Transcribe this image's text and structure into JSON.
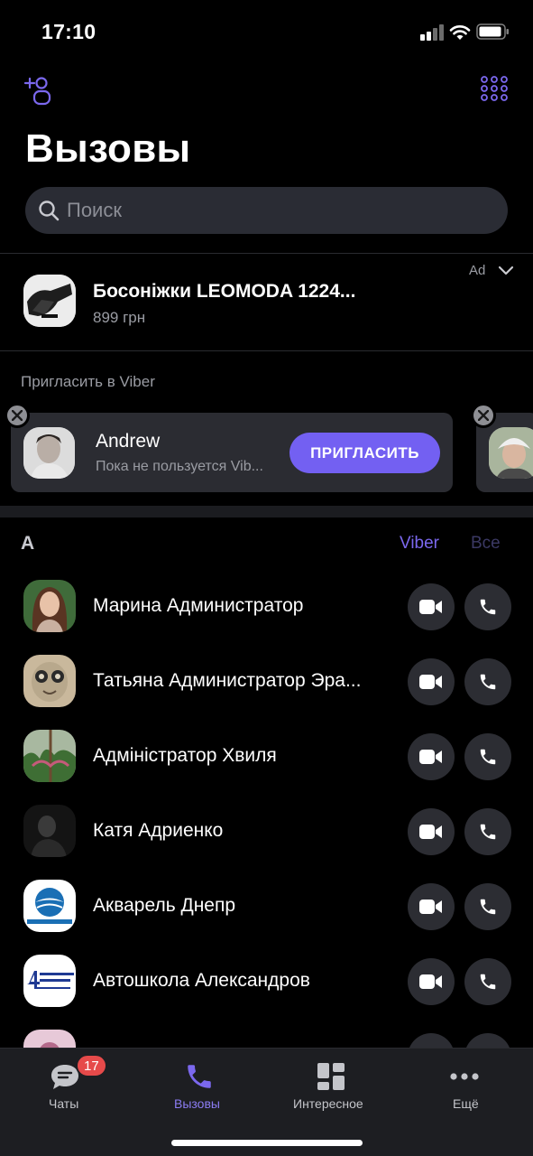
{
  "status_bar": {
    "time": "17:10"
  },
  "header": {
    "title": "Вызовы"
  },
  "search": {
    "placeholder": "Поиск"
  },
  "ad": {
    "title": "Босоніжки LEOMODA 1224...",
    "price": "899 грн",
    "label": "Ad"
  },
  "invite": {
    "heading": "Пригласить в Viber",
    "contact_name": "Andrew",
    "subtitle": "Пока не пользуется Vib...",
    "button_label": "ПРИГЛАСИТЬ"
  },
  "contacts_section": {
    "letter": "А",
    "filter_viber": "Viber",
    "filter_all": "Все",
    "contacts": [
      {
        "name": "Марина Администратор"
      },
      {
        "name": "Татьяна Администратор Эра..."
      },
      {
        "name": "Адміністратор Хвиля"
      },
      {
        "name": "Катя Адриенко"
      },
      {
        "name": "Акварель Днепр"
      },
      {
        "name": "Автошкола Александров"
      },
      {
        "name": ""
      }
    ]
  },
  "tabbar": {
    "chats": "Чаты",
    "chats_badge": "17",
    "calls": "Вызовы",
    "explore": "Интересное",
    "more": "Ещё"
  },
  "colors": {
    "accent": "#7360f2",
    "accent_text": "#7b68ee",
    "badge": "#e64a4a",
    "background": "#000000"
  }
}
